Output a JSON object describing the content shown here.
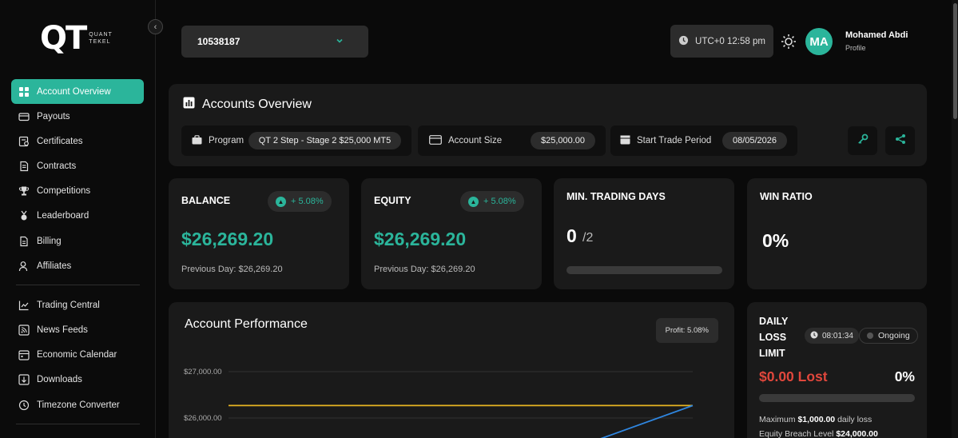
{
  "brand": {
    "logo_main": "QT",
    "logo_line1": "QUANT",
    "logo_line2": "TEKEL"
  },
  "sidebar": {
    "items": [
      {
        "label": "Account Overview",
        "icon": "grid-icon",
        "active": true
      },
      {
        "label": "Payouts",
        "icon": "credit-card-icon"
      },
      {
        "label": "Certificates",
        "icon": "certificate-icon"
      },
      {
        "label": "Contracts",
        "icon": "contract-icon"
      },
      {
        "label": "Competitions",
        "icon": "trophy-icon"
      },
      {
        "label": "Leaderboard",
        "icon": "medal-icon"
      },
      {
        "label": "Billing",
        "icon": "document-icon"
      },
      {
        "label": "Affiliates",
        "icon": "user-icon"
      }
    ],
    "items2": [
      {
        "label": "Trading Central",
        "icon": "chart-icon"
      },
      {
        "label": "News Feeds",
        "icon": "rss-icon"
      },
      {
        "label": "Economic Calendar",
        "icon": "calendar-icon"
      },
      {
        "label": "Downloads",
        "icon": "download-icon"
      },
      {
        "label": "Timezone Converter",
        "icon": "clock-icon"
      }
    ]
  },
  "header": {
    "account_number": "10538187",
    "time": "UTC+0 12:58 pm",
    "user": {
      "initials": "MA",
      "name": "Mohamed Abdi",
      "role": "Profile"
    }
  },
  "overview": {
    "title": "Accounts Overview",
    "program_label": "Program",
    "program_value": "QT 2 Step - Stage 2 $25,000 MT5",
    "size_label": "Account Size",
    "size_value": "$25,000.00",
    "start_label": "Start Trade Period",
    "start_value": "08/05/2026"
  },
  "cards": {
    "balance": {
      "title": "BALANCE",
      "change": "+ 5.08%",
      "value": "$26,269.20",
      "previous": "Previous Day: $26,269.20"
    },
    "equity": {
      "title": "EQUITY",
      "change": "+ 5.08%",
      "value": "$26,269.20",
      "previous": "Previous Day: $26,269.20"
    },
    "trading_days": {
      "title": "MIN. TRADING DAYS",
      "value": "0",
      "total": "/2",
      "progress": 0
    },
    "win_ratio": {
      "title": "WIN RATIO",
      "value": "0%"
    }
  },
  "performance": {
    "title": "Account Performance",
    "profit": "Profit: 5.08%"
  },
  "chart_data": {
    "type": "line",
    "title": "Account Performance",
    "y_ticks": [
      "$27,000.00",
      "$26,000.00"
    ],
    "ylim": [
      25500,
      27150
    ],
    "series": [
      {
        "color": "#e6b422",
        "values": [
          26269.2,
          26269.2
        ]
      },
      {
        "color": "#2f86e0",
        "values": [
          25550,
          26269.2
        ]
      }
    ]
  },
  "daily_loss": {
    "title": "DAILY LOSS LIMIT",
    "timer": "08:01:34",
    "status": "Ongoing",
    "lost": "$0.00 Lost",
    "percent": "0%",
    "progress": 0,
    "max_prefix": "Maximum",
    "max_value": "$1,000.00",
    "max_suffix": "daily loss",
    "breach_prefix": "Equity Breach Level",
    "breach_value": "$24,000.00"
  },
  "colors": {
    "accent": "#2bb59b",
    "danger": "#e0473c"
  }
}
